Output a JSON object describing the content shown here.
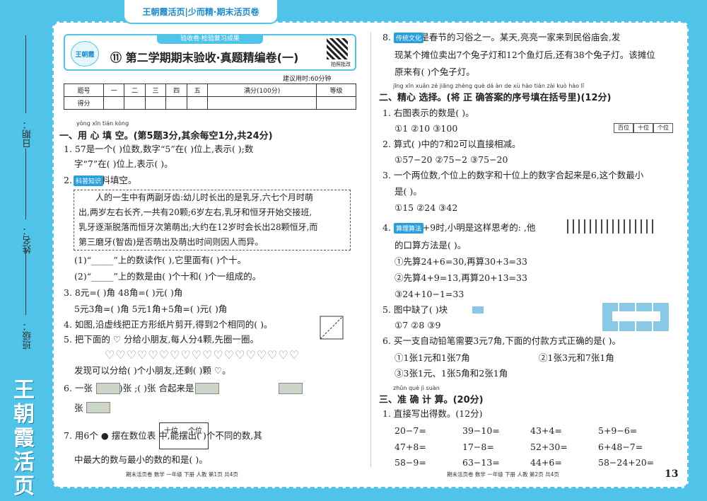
{
  "tab": "王朝霞活页|少而精·期末活页卷",
  "brand": "王朝霞活页",
  "spine": {
    "date": "日期：",
    "name": "姓名：",
    "class": "班级："
  },
  "header": {
    "strip": "验收卷·检验复习成果",
    "logo": "王朝霞",
    "title": "⑪ 第二学期期末验收·真题精编卷(一)",
    "qr": "拍照批改",
    "time": "建议用时:60分钟"
  },
  "score": {
    "row1": [
      "题号",
      "一",
      "二",
      "三",
      "四",
      "五",
      "满分(100分)",
      "等级"
    ],
    "row2": "得分"
  },
  "s1": {
    "py": "yòng xīn tián kòng",
    "title": "一、用 心 填 空。(第5题3分,其余每空1分,共24分)"
  },
  "q1a": "1. 57是一个(        )位数,数字“5”在(        )位上,表示(        );数",
  "q1b": "字“7”在(        )位上,表示(        )。",
  "q2tag": "科普知识",
  "q2": "2.        阅读材料填空。",
  "p1": "人的一生中有两副牙齿:幼儿时长出的是乳牙,六七个月时萌",
  "p2": "出,两岁左右长齐,一共有20颗;6岁左右,乳牙和恒牙开始交接班,",
  "p3": "乳牙逐渐脱落而恒牙次第萌出;大约在12岁时会长出28颗恒牙,而",
  "p4": "第三磨牙(智齿)是否萌出及萌出时间则因人而异。",
  "q2a": "(1)“_____”上的数读作(        ),它里面有(        )个十。",
  "q2b": "(2)“_____”上的数是由(        )个十和(        )个一组成的。",
  "q3a": "3. 8元=(        )角                 48角=(        )元(        )角",
  "q3b": "5元3角=(        )角            5元1角+5角=(        )元(        )角",
  "q4": "4. 如图,沿虚线把正方形纸片剪开,得到2个相同的(        )。",
  "q5": "5. 把下面的 ♡ 分给小朋友,每人分4颗,先圈一圈。",
  "hearts": "♡♡♡♡♡♡♡♡♡♡♡♡♡♡♡♡♡♡",
  "q5b": "发现可以分给(        )个小朋友,还剩(        )颗 ♡。",
  "q6a": "6. 一张         能换(        )张        ;(        )张         合起来是1",
  "q6b": "张        。",
  "q7a": "7. 用6个 ● 摆在数位表                      中,能摆出(        )个不同的数,其",
  "q7b": "中最大的数与最小的数的和是(        )。",
  "pvh": [
    "十位",
    "个位"
  ],
  "q8tag": "传统文化",
  "q8a": "8.         逛庙会是春节的习俗之一。某天,亮亮一家来到民俗庙会,发",
  "q8b": "现某个摊位卖出7个兔子灯和12个鱼灯后,还有38个兔子灯。该摊位",
  "q8c": "原来有(        )个兔子灯。",
  "s2": {
    "py": "jīng xīn xuǎn zé   jiāng zhèng què dá àn de xù hào tián zài kuò hào lǐ",
    "title": "二、精心 选择。(将 正 确答案的序号填在括号里)(12分)"
  },
  "c1": "1. 右图表示的数是(        )。",
  "c1o": "①1                  ②10                  ③100",
  "beads": [
    "百位",
    "十位",
    "个位"
  ],
  "c2": "2. 算式(        )中的7和2可以直接相减。",
  "c2o": "①57−20             ②75−2              ③75−20",
  "c3a": "3. 一个两位数,个位上的数字和十位上的数字合起来是6,这个数最小",
  "c3b": "是(        )。",
  "c3o": "①15                ②24                ③42",
  "c4tag": "算理算法",
  "c4a": "4.        计算24+9时,小明是这样思考的:                              ,他",
  "c4b": "的口算方法是(        )。",
  "c4o1": "①先算24+6=30,再算30+3=33",
  "c4o2": "②先算4+9=13,再算20+13=33",
  "c4o3": "③24+10−1=33",
  "c5": "5. 图中缺了(        )块",
  "c5o": "①7                  ②8                  ③9",
  "c6": "6. 买一支自动铅笔需要3元7角,下面的付款方式正确的是(        )。",
  "c6o1": "①1张1元和1张7角",
  "c6o2": "②1张3元和7张1角",
  "c6o3": "③3张1元、1张5角和2张1角",
  "s3": {
    "py": "zhǔn què  jì  suàn",
    "title": "三、准 确 计 算。(20分)"
  },
  "calc": "1. 直接写出得数。(12分)",
  "r1": [
    "20−7=",
    "39−10=",
    "43+4=",
    "5+9−6="
  ],
  "r2": [
    "47+8=",
    "17−8=",
    "52+30=",
    "6+48−7="
  ],
  "r3": [
    "58−9=",
    "63−13=",
    "44+6=",
    "58−24+20="
  ],
  "foot1": "期末活页卷   数学   一年级   下册   人教   第1页   共4页",
  "foot2": "期末活页卷   数学   一年级   下册   人教   第2页   共4页",
  "page": "13"
}
